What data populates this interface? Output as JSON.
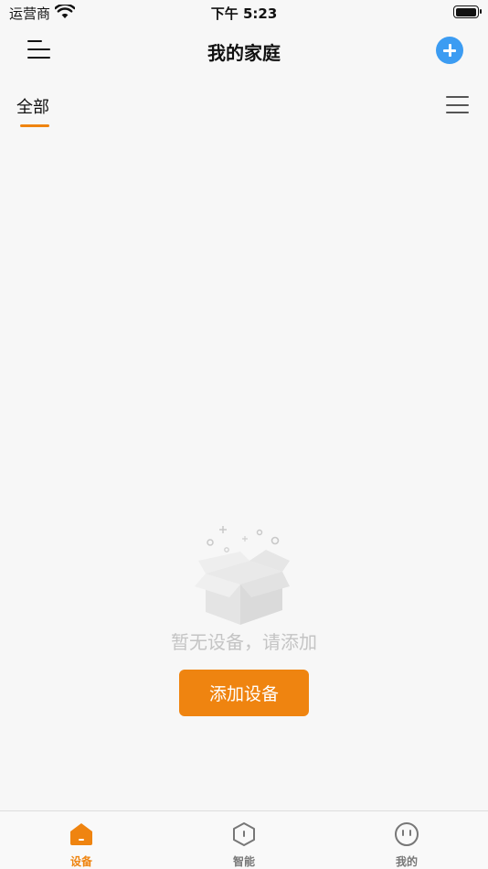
{
  "status_bar": {
    "carrier": "运营商",
    "time": "下午 5:23"
  },
  "header": {
    "title": "我的家庭",
    "menu_icon": "menu-icon",
    "add_icon": "plus-circle-icon"
  },
  "room_tabs": {
    "items": [
      {
        "label": "全部",
        "active": true
      }
    ],
    "list_icon": "list-icon"
  },
  "empty_state": {
    "icon": "empty-box-icon",
    "message": "暂无设备，请添加",
    "button_label": "添加设备"
  },
  "tab_bar": {
    "items": [
      {
        "label": "设备",
        "icon": "home-icon",
        "active": true
      },
      {
        "label": "智能",
        "icon": "hexagon-icon",
        "active": false
      },
      {
        "label": "我的",
        "icon": "profile-face-icon",
        "active": false
      }
    ]
  },
  "colors": {
    "accent": "#ef8410",
    "add_button": "#3c9cf2",
    "background": "#f7f7f7",
    "muted_text": "#c4c4c4"
  }
}
